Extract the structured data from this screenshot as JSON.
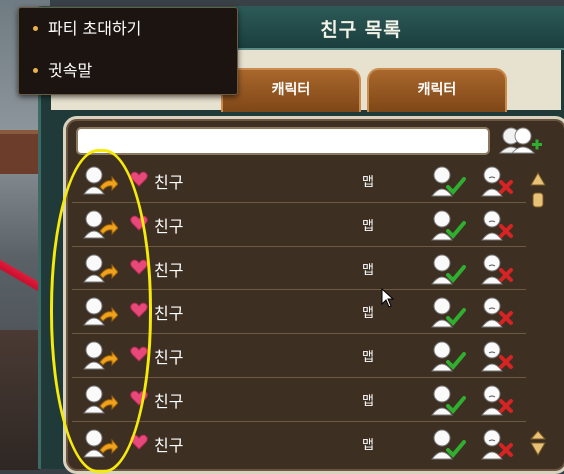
{
  "window": {
    "title": "친구 목록"
  },
  "tabs": [
    {
      "label": "캐릭터"
    },
    {
      "label": "캐릭터"
    }
  ],
  "search": {
    "value": ""
  },
  "context_menu": {
    "items": [
      {
        "label": "파티 초대하기"
      },
      {
        "label": "귓속말"
      }
    ]
  },
  "friends": [
    {
      "name": "친구",
      "map": "맵"
    },
    {
      "name": "친구",
      "map": "맵"
    },
    {
      "name": "친구",
      "map": "맵"
    },
    {
      "name": "친구",
      "map": "맵"
    },
    {
      "name": "친구",
      "map": "맵"
    },
    {
      "name": "친구",
      "map": "맵"
    },
    {
      "name": "친구",
      "map": "맵"
    }
  ],
  "icons": {
    "go_to": "person-arrow-icon",
    "favorite": "heart-icon",
    "accept": "person-check-icon",
    "reject": "person-x-icon",
    "add_friend": "add-friend-icon"
  },
  "colors": {
    "highlight": "#f5ea0a",
    "heart": "#e7497a",
    "check": "#2fae2f",
    "reject": "#d62323"
  }
}
